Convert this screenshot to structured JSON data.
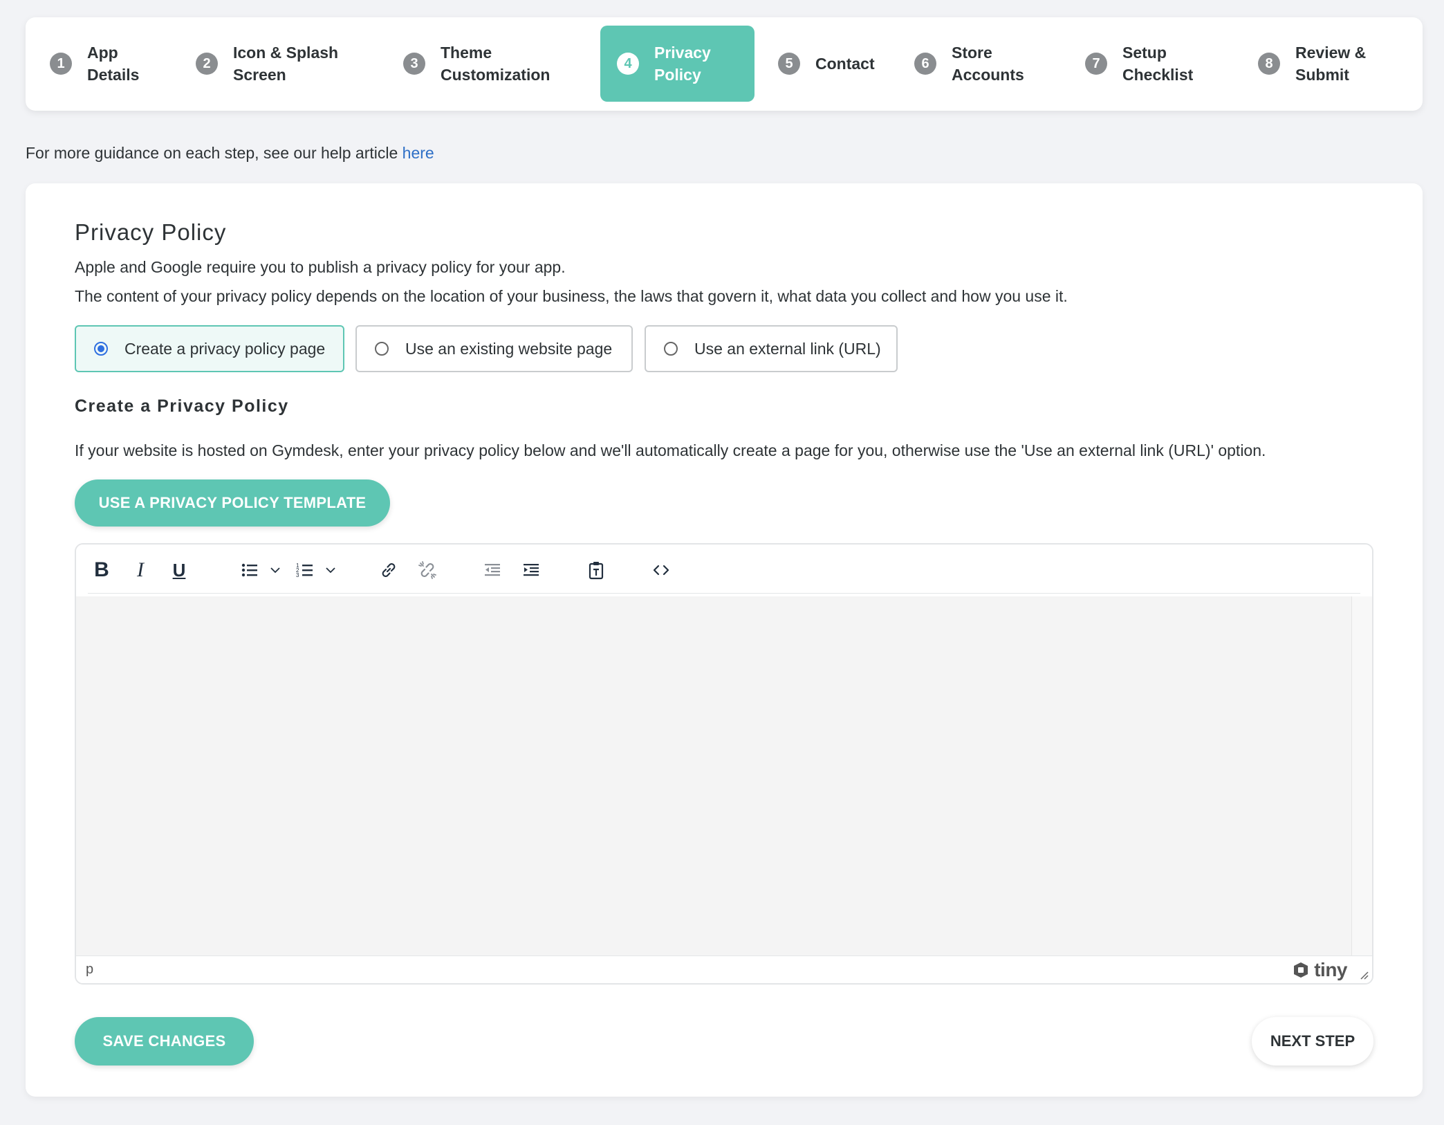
{
  "stepper": {
    "steps": [
      {
        "num": "1",
        "label": "App\nDetails"
      },
      {
        "num": "2",
        "label": "Icon & Splash\nScreen"
      },
      {
        "num": "3",
        "label": "Theme\nCustomization"
      },
      {
        "num": "4",
        "label": "Privacy\nPolicy"
      },
      {
        "num": "5",
        "label": "Contact"
      },
      {
        "num": "6",
        "label": "Store\nAccounts"
      },
      {
        "num": "7",
        "label": "Setup\nChecklist"
      },
      {
        "num": "8",
        "label": "Review &\nSubmit"
      }
    ],
    "active_step": "4"
  },
  "help": {
    "text": "For more guidance on each step, see our help article ",
    "link": "here"
  },
  "privacy": {
    "title": "Privacy Policy",
    "desc1": "Apple and Google require you to publish a privacy policy for your app.",
    "desc2": "The content of your privacy policy depends on the location of your business, the laws that govern it, what data you collect and how you use it.",
    "options": [
      {
        "label": "Create a privacy policy page",
        "selected": true
      },
      {
        "label": "Use an existing website page",
        "selected": false
      },
      {
        "label": "Use an external link (URL)",
        "selected": false
      }
    ],
    "subtitle": "Create a Privacy Policy",
    "info": "If your website is hosted on Gymdesk, enter your privacy policy below and we'll automatically create a page for you, otherwise use the 'Use an external link (URL)' option.",
    "template_button": "USE A PRIVACY POLICY TEMPLATE"
  },
  "editor": {
    "toolbar": {
      "bold": "B",
      "italic": "I",
      "underline": "U"
    },
    "status_path": "p",
    "brand": "tiny"
  },
  "actions": {
    "save": "SAVE CHANGES",
    "next": "NEXT STEP"
  },
  "colors": {
    "accent": "#5ec6b3",
    "link": "#2e6fc6",
    "radio_selected": "#2e6fe0"
  }
}
